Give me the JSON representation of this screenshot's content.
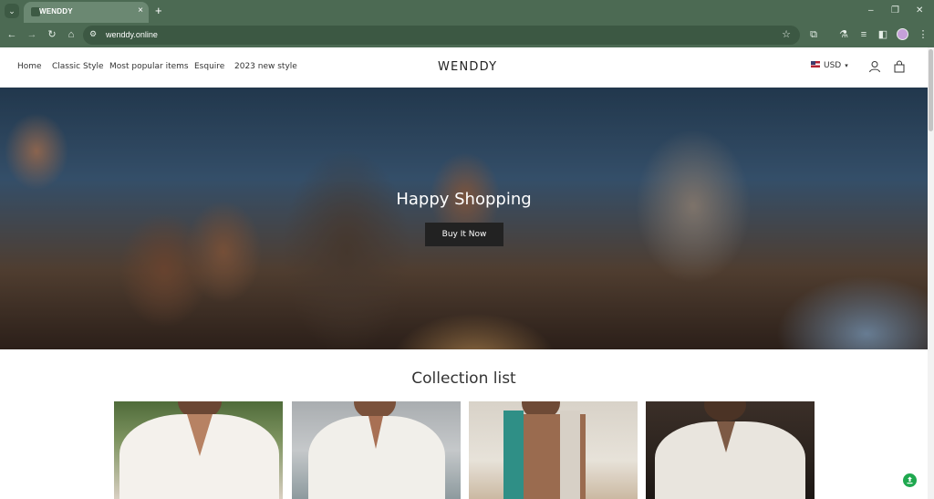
{
  "browser": {
    "tab_title": "WENDDY",
    "tab_close": "×",
    "new_tab": "+",
    "url": "wenddy.online",
    "icons": [
      "tab-search-icon",
      "back-icon",
      "forward-icon",
      "reload-icon",
      "home-icon",
      "site-info-icon",
      "star-icon",
      "extensions-icon",
      "lab-icon",
      "media-icon",
      "sidebar-icon",
      "profile-icon",
      "more-icon",
      "minimize-icon",
      "restore-icon",
      "close-icon"
    ],
    "window": {
      "minimize": "–",
      "restore": "❐",
      "close": "✕"
    }
  },
  "header": {
    "nav": [
      "Home",
      "Classic Style",
      "Most popular items",
      "Esquire",
      "2023 new style"
    ],
    "brand": "WENDDY",
    "currency": "USD",
    "icons": [
      "flag-us-icon",
      "chevron-down-icon",
      "account-icon",
      "cart-icon"
    ]
  },
  "hero": {
    "title": "Happy Shopping",
    "button": "Buy It Now"
  },
  "collection": {
    "title": "Collection list",
    "items": [
      {
        "image": "man-white-open-shirt-necklace"
      },
      {
        "image": "man-white-lace-up-shirt"
      },
      {
        "image": "man-teal-cardigan-open"
      },
      {
        "image": "man-white-shirt-dark-background"
      }
    ]
  },
  "colors": {
    "chrome": "#4c6a53",
    "button": "#222222"
  },
  "widget": {
    "icon": "support-chat-icon",
    "color": "#1fa84f"
  }
}
